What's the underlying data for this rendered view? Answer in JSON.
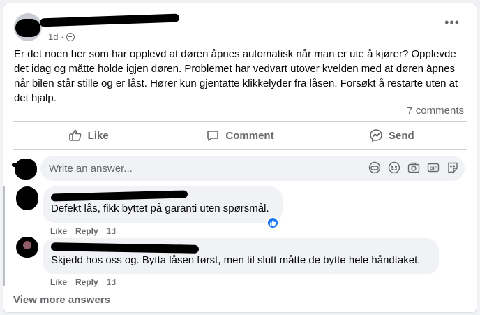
{
  "post": {
    "author_name": "",
    "time": "1d ·",
    "privacy_icon": "globe-icon",
    "more_icon": "more-horizontal-icon",
    "text": "Er det noen her som har opplevd at døren åpnes automatisk når man er ute å kjører? Opplevde det idag og måtte holde igjen døren. Problemet har vedvart utover kvelden med at døren åpnes når bilen står stille og er låst. Hører kun gjentatte klikkelyder fra låsen. Forsøkt å restarte uten at det hjalp.",
    "comments_count": "7 comments"
  },
  "actions": {
    "like": "Like",
    "comment": "Comment",
    "send": "Send"
  },
  "composer": {
    "placeholder": "Write an answer..."
  },
  "comments": [
    {
      "text": "Defekt lås, fikk byttet på garanti uten spørsmål.",
      "like": "Like",
      "reply": "Reply",
      "time": "1d"
    },
    {
      "text": "Skjedd hos oss og. Bytta låsen først, men til slutt måtte de bytte hele håndtaket.",
      "like": "Like",
      "reply": "Reply",
      "time": "1d"
    }
  ],
  "view_more": "View more answers",
  "colors": {
    "accent": "#1877f2",
    "muted": "#65676b",
    "bubble": "#f0f2f5"
  }
}
